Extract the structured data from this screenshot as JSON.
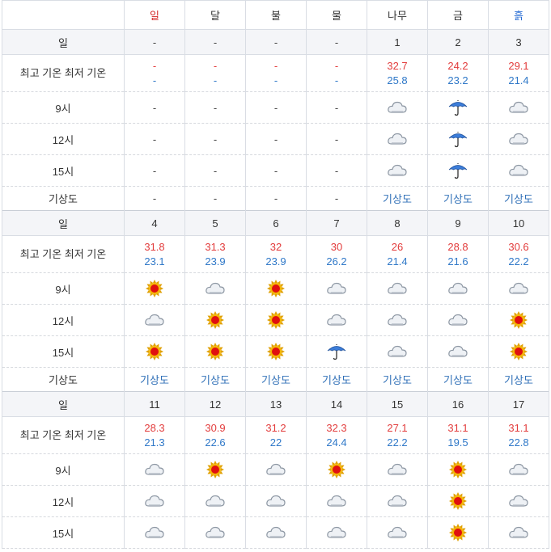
{
  "headers": [
    {
      "label": "",
      "cls": ""
    },
    {
      "label": "일",
      "cls": "sun"
    },
    {
      "label": "달",
      "cls": ""
    },
    {
      "label": "불",
      "cls": ""
    },
    {
      "label": "물",
      "cls": ""
    },
    {
      "label": "나무",
      "cls": ""
    },
    {
      "label": "금",
      "cls": ""
    },
    {
      "label": "흙",
      "cls": "sat"
    }
  ],
  "row_labels": {
    "day": "일",
    "temp": "최고 기온 최저 기온",
    "h9": "9시",
    "h12": "12시",
    "h15": "15시",
    "map": "기상도"
  },
  "icon_names": {
    "sunny": "sun-icon",
    "cloudy": "cloud-icon",
    "rain": "umbrella-icon"
  },
  "weeks": [
    {
      "days": [
        "-",
        "-",
        "-",
        "-",
        "1",
        "2",
        "3"
      ],
      "highs": [
        "-",
        "-",
        "-",
        "-",
        "32.7",
        "24.2",
        "29.1"
      ],
      "lows": [
        "-",
        "-",
        "-",
        "-",
        "25.8",
        "23.2",
        "21.4"
      ],
      "h9": [
        "-",
        "-",
        "-",
        "-",
        "cloudy",
        "rain",
        "cloudy"
      ],
      "h12": [
        "-",
        "-",
        "-",
        "-",
        "cloudy",
        "rain",
        "cloudy"
      ],
      "h15": [
        "-",
        "-",
        "-",
        "-",
        "cloudy",
        "rain",
        "cloudy"
      ],
      "map": [
        "-",
        "-",
        "-",
        "-",
        "기상도",
        "기상도",
        "기상도"
      ]
    },
    {
      "days": [
        "4",
        "5",
        "6",
        "7",
        "8",
        "9",
        "10"
      ],
      "highs": [
        "31.8",
        "31.3",
        "32",
        "30",
        "26",
        "28.8",
        "30.6"
      ],
      "lows": [
        "23.1",
        "23.9",
        "23.9",
        "26.2",
        "21.4",
        "21.6",
        "22.2"
      ],
      "h9": [
        "sunny",
        "cloudy",
        "sunny",
        "cloudy",
        "cloudy",
        "cloudy",
        "cloudy"
      ],
      "h12": [
        "cloudy",
        "sunny",
        "sunny",
        "cloudy",
        "cloudy",
        "cloudy",
        "sunny"
      ],
      "h15": [
        "sunny",
        "sunny",
        "sunny",
        "rain",
        "cloudy",
        "cloudy",
        "sunny"
      ],
      "map": [
        "기상도",
        "기상도",
        "기상도",
        "기상도",
        "기상도",
        "기상도",
        "기상도"
      ]
    },
    {
      "days": [
        "11",
        "12",
        "13",
        "14",
        "15",
        "16",
        "17"
      ],
      "highs": [
        "28.3",
        "30.9",
        "31.2",
        "32.3",
        "27.1",
        "31.1",
        "31.1"
      ],
      "lows": [
        "21.3",
        "22.6",
        "22",
        "24.4",
        "22.2",
        "19.5",
        "22.8"
      ],
      "h9": [
        "cloudy",
        "sunny",
        "cloudy",
        "sunny",
        "cloudy",
        "sunny",
        "cloudy"
      ],
      "h12": [
        "cloudy",
        "cloudy",
        "cloudy",
        "cloudy",
        "cloudy",
        "sunny",
        "cloudy"
      ],
      "h15": [
        "cloudy",
        "cloudy",
        "cloudy",
        "cloudy",
        "cloudy",
        "sunny",
        "cloudy"
      ],
      "map": []
    }
  ]
}
